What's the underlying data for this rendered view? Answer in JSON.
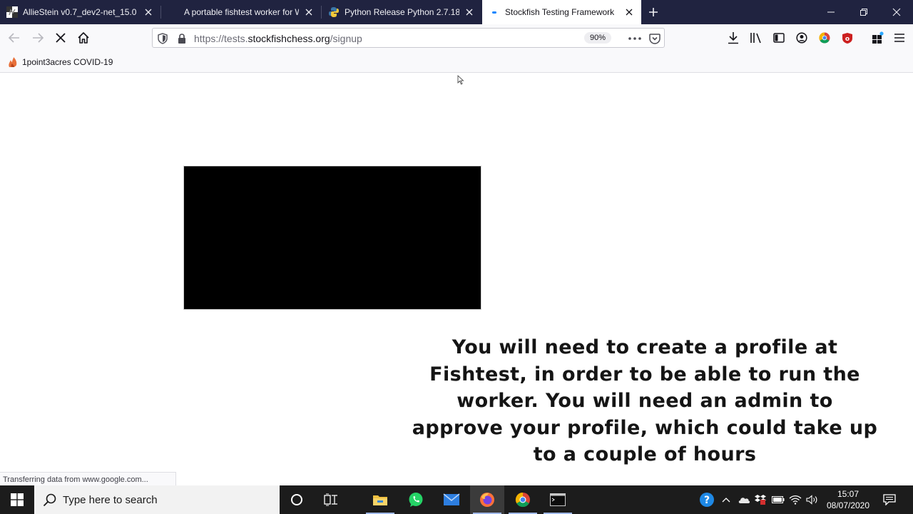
{
  "browser": {
    "tabs": [
      {
        "title": "AllieStein v0.7_dev2-net_15.0 v",
        "icon": "chess-board-icon",
        "active": false
      },
      {
        "title": "A portable fishtest worker for W",
        "icon": "blank-page-icon",
        "active": false
      },
      {
        "title": "Python Release Python 2.7.18 | P",
        "icon": "python-logo-icon",
        "active": false
      },
      {
        "title": "Stockfish Testing Framework",
        "icon": "loading-dot-icon",
        "active": true
      }
    ],
    "url": {
      "scheme": "https://tests.",
      "host": "stockfishchess.org",
      "path": "/signup"
    },
    "zoom": "90%",
    "bookmark": "1point3acres COVID-19",
    "status_text": "Transferring data from www.google.com..."
  },
  "page": {
    "caption": "You will need to create a profile at Fishtest, in order to be able to run the worker. You will need an admin to approve your profile, which could take up to a couple of hours"
  },
  "taskbar": {
    "search_placeholder": "Type here to search",
    "time": "15:07",
    "date": "08/07/2020"
  },
  "colors": {
    "tabbar_bg": "#202340",
    "accent_blue": "#0a84ff",
    "taskbar_bg": "#1c1c1c"
  }
}
